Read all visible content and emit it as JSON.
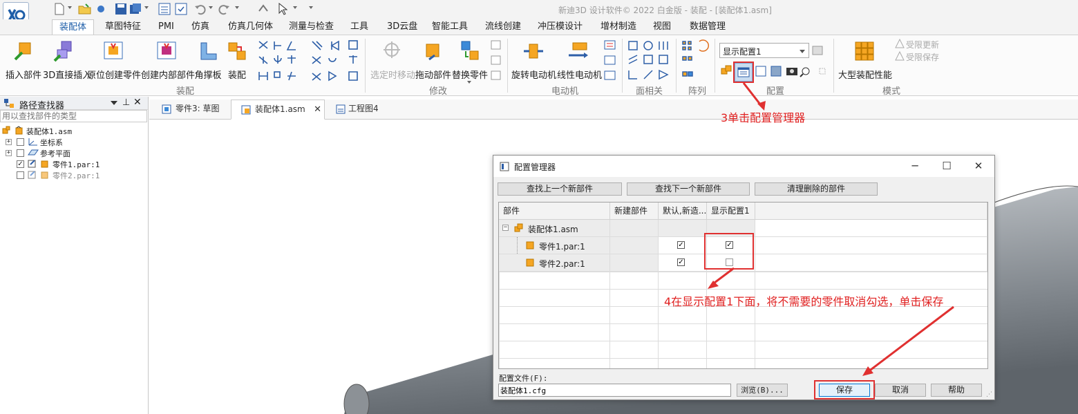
{
  "window": {
    "title": "新迪3D 设计软件© 2022 白金版 - 装配 - [装配体1.asm]"
  },
  "ribbon_tabs": [
    "装配体",
    "草图特征",
    "PMI",
    "仿真",
    "仿真几何体",
    "测量与检查",
    "工具",
    "3D云盘",
    "智能工具",
    "流线创建",
    "冲压模设计",
    "增材制造",
    "视图",
    "数据管理"
  ],
  "ribbon": {
    "assembly_group": {
      "label": "装配",
      "buttons": [
        "插入部件",
        "3D直接插入",
        "原位创建零件",
        "创建内部部件",
        "角撑板",
        "装配"
      ]
    },
    "modify_group": {
      "label": "修改",
      "buttons": [
        "选定时移动",
        "拖动部件",
        "替换零件"
      ]
    },
    "motor_group": {
      "label": "电动机",
      "buttons": [
        "旋转电动机",
        "线性电动机"
      ]
    },
    "face_group": {
      "label": "面相关"
    },
    "pattern_group": {
      "label": "阵列"
    },
    "config_group": {
      "label": "配置",
      "dropdown_value": "显示配置1"
    },
    "mode_group": {
      "label": "模式",
      "big_button": "大型装配性能",
      "small_buttons": [
        "受限更新",
        "受限保存"
      ]
    }
  },
  "pathfinder": {
    "title": "路径查找器",
    "filter_placeholder": "用以查找部件的类型",
    "tree": [
      {
        "label": "装配体1.asm",
        "level": 0
      },
      {
        "label": "坐标系",
        "level": 1
      },
      {
        "label": "参考平面",
        "level": 1
      },
      {
        "label": "零件1.par:1",
        "level": 1,
        "checked": true
      },
      {
        "label": "零件2.par:1",
        "level": 1,
        "checked": false
      }
    ]
  },
  "doc_tabs": [
    {
      "label": "零件3: 草图",
      "active": false
    },
    {
      "label": "装配体1.asm",
      "active": true
    },
    {
      "label": "工程图4",
      "active": false
    }
  ],
  "dialog": {
    "title": "配置管理器",
    "buttons": {
      "find_prev": "查找上一个新部件",
      "find_next": "查找下一个新部件",
      "clean_deleted": "清理删除的部件"
    },
    "columns": [
      "部件",
      "新建部件",
      "默认,新造...",
      "显示配置1"
    ],
    "rows": [
      {
        "name": "装配体1.asm",
        "default": null,
        "display1": null
      },
      {
        "name": "零件1.par:1",
        "default": true,
        "display1": true
      },
      {
        "name": "零件2.par:1",
        "default": true,
        "display1": false
      }
    ],
    "config_file_label": "配置文件(F):",
    "config_file_value": "装配体1.cfg",
    "browse_label": "浏览(B)...",
    "save_label": "保存",
    "cancel_label": "取消",
    "help_label": "帮助"
  },
  "annotations": {
    "step3": "3单击配置管理器",
    "step4": "4在显示配置1下面，将不需要的零件取消勾选，单击保存"
  },
  "colors": {
    "accent": "#1e5ea8",
    "annotation": "#e02020"
  }
}
